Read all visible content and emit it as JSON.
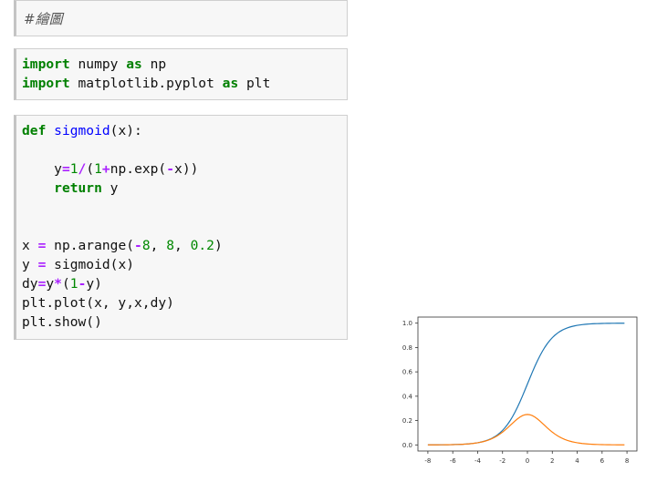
{
  "cells": {
    "markdown": {
      "text": "#繪圖"
    },
    "imports": {
      "lines": [
        [
          {
            "t": "import",
            "c": "kw"
          },
          {
            "t": " numpy ",
            "c": ""
          },
          {
            "t": "as",
            "c": "kw"
          },
          {
            "t": " np",
            "c": ""
          }
        ],
        [
          {
            "t": "import",
            "c": "kw"
          },
          {
            "t": " matplotlib.pyplot ",
            "c": ""
          },
          {
            "t": "as",
            "c": "kw"
          },
          {
            "t": " plt",
            "c": ""
          }
        ]
      ]
    },
    "code": {
      "lines": [
        [
          {
            "t": "def",
            "c": "kw"
          },
          {
            "t": " ",
            "c": ""
          },
          {
            "t": "sigmoid",
            "c": "fn"
          },
          {
            "t": "(x):",
            "c": ""
          }
        ],
        [],
        [
          {
            "t": "    y",
            "c": ""
          },
          {
            "t": "=",
            "c": "op"
          },
          {
            "t": "1",
            "c": "num"
          },
          {
            "t": "/",
            "c": "op"
          },
          {
            "t": "(",
            "c": ""
          },
          {
            "t": "1",
            "c": "num"
          },
          {
            "t": "+",
            "c": "op"
          },
          {
            "t": "np.exp(",
            "c": ""
          },
          {
            "t": "-",
            "c": "op"
          },
          {
            "t": "x))",
            "c": ""
          }
        ],
        [
          {
            "t": "    ",
            "c": ""
          },
          {
            "t": "return",
            "c": "kw"
          },
          {
            "t": " y",
            "c": ""
          }
        ],
        [],
        [],
        [
          {
            "t": "x ",
            "c": ""
          },
          {
            "t": "=",
            "c": "op"
          },
          {
            "t": " np.arange(",
            "c": ""
          },
          {
            "t": "-",
            "c": "op"
          },
          {
            "t": "8",
            "c": "num"
          },
          {
            "t": ", ",
            "c": ""
          },
          {
            "t": "8",
            "c": "num"
          },
          {
            "t": ", ",
            "c": ""
          },
          {
            "t": "0.2",
            "c": "num"
          },
          {
            "t": ")",
            "c": ""
          }
        ],
        [
          {
            "t": "y ",
            "c": ""
          },
          {
            "t": "=",
            "c": "op"
          },
          {
            "t": " sigmoid(x)",
            "c": ""
          }
        ],
        [
          {
            "t": "dy",
            "c": ""
          },
          {
            "t": "=",
            "c": "op"
          },
          {
            "t": "y",
            "c": ""
          },
          {
            "t": "*",
            "c": "op"
          },
          {
            "t": "(",
            "c": ""
          },
          {
            "t": "1",
            "c": "num"
          },
          {
            "t": "-",
            "c": "op"
          },
          {
            "t": "y)",
            "c": ""
          }
        ],
        [
          {
            "t": "plt.plot(x, y,x,dy)",
            "c": ""
          }
        ],
        [
          {
            "t": "plt.show()",
            "c": ""
          }
        ]
      ]
    }
  },
  "chart_data": {
    "type": "line",
    "x_range": [
      -8,
      8
    ],
    "x_step": 0.2,
    "ylim": [
      0,
      1
    ],
    "x_ticks": [
      "-8",
      "-6",
      "-4",
      "-2",
      "0",
      "2",
      "4",
      "6",
      "8"
    ],
    "y_ticks": [
      "0.0",
      "0.2",
      "0.4",
      "0.6",
      "0.8",
      "1.0"
    ],
    "series": [
      {
        "function": "sigmoid",
        "color": "#1f77b4"
      },
      {
        "function": "sigmoid_derivative",
        "color": "#ff7f0e"
      }
    ],
    "grid": false
  }
}
